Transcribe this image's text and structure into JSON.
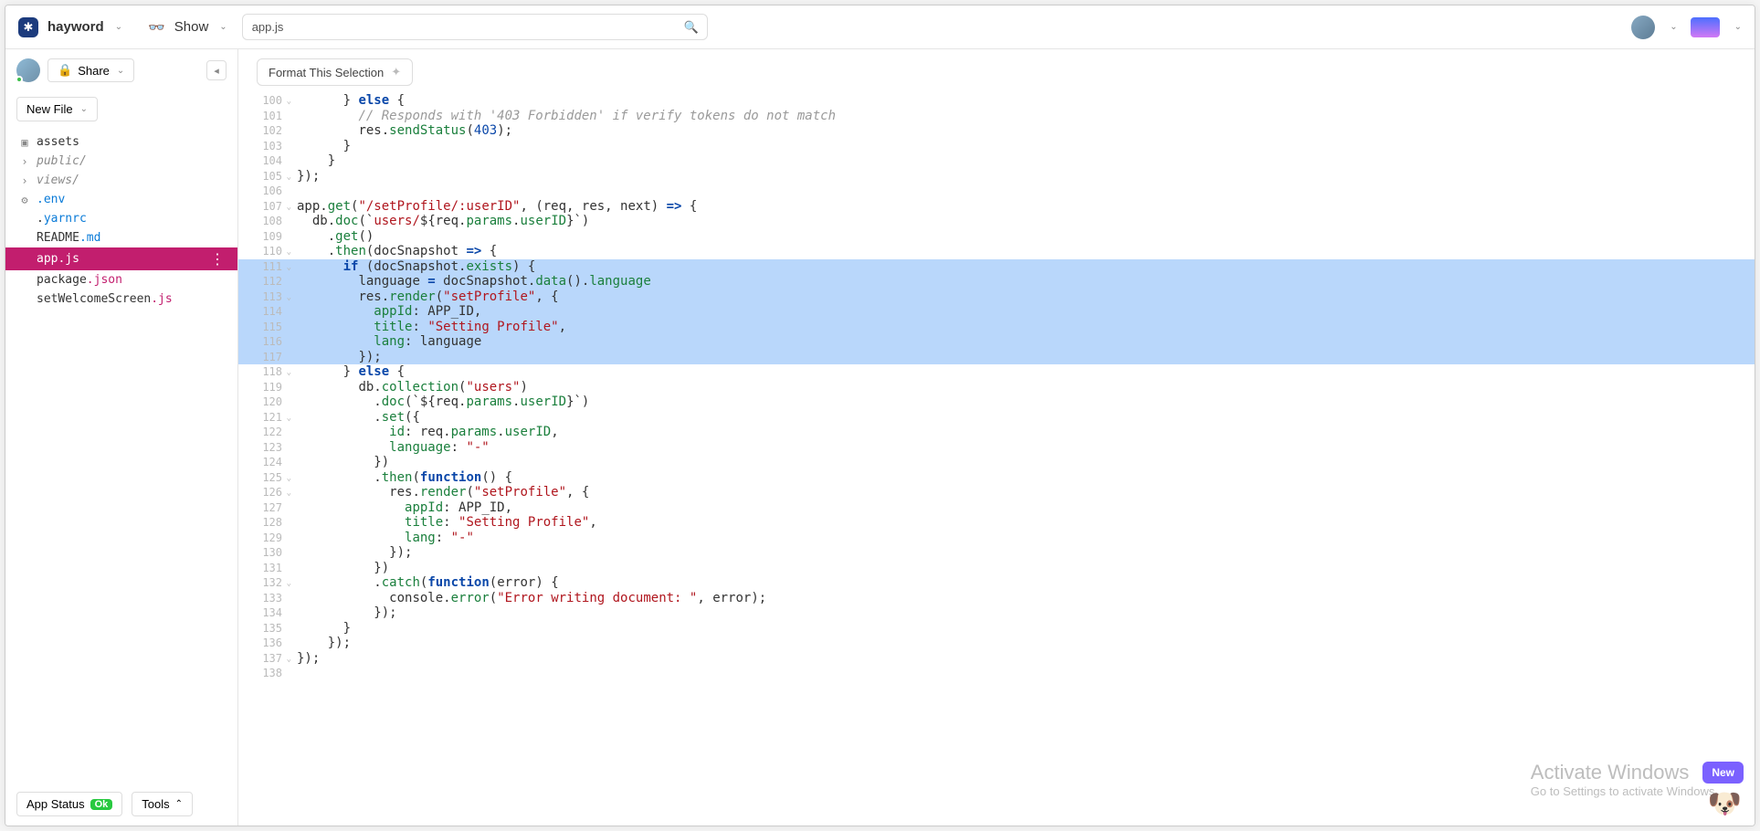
{
  "header": {
    "project": "hayword",
    "show_label": "Show",
    "search_value": "app.js"
  },
  "sidebar": {
    "share_label": "Share",
    "new_file_label": "New File",
    "tree": [
      {
        "icon": "▣",
        "prefix": "",
        "name": "assets",
        "suffix": "",
        "cls": ""
      },
      {
        "icon": "›",
        "prefix": "",
        "name": "public/",
        "suffix": "",
        "cls": "muted"
      },
      {
        "icon": "›",
        "prefix": "",
        "name": "views/",
        "suffix": "",
        "cls": "muted"
      },
      {
        "icon": "⚙",
        "prefix": "",
        "name": ".env",
        "suffix": "",
        "cls": "ext-env"
      },
      {
        "icon": "",
        "prefix": ".",
        "name": "yarnrc",
        "suffix": "",
        "cls": "ext-rc",
        "pname": ".yarnrc"
      },
      {
        "icon": "",
        "prefix": "README",
        "name": ".md",
        "suffix": "",
        "cls": "ext-md"
      },
      {
        "icon": "",
        "prefix": "app",
        "name": ".js",
        "suffix": "",
        "cls": "ext-js",
        "active": true
      },
      {
        "icon": "",
        "prefix": "package",
        "name": ".json",
        "suffix": "",
        "cls": "ext-json"
      },
      {
        "icon": "",
        "prefix": "setWelcomeScreen",
        "name": ".js",
        "suffix": "",
        "cls": "ext-js"
      }
    ],
    "app_status_label": "App Status",
    "app_status_value": "Ok",
    "tools_label": "Tools"
  },
  "editor": {
    "format_btn": "Format This Selection",
    "lines": [
      {
        "num": 100,
        "fold": true,
        "sel": false,
        "indent": "      ",
        "tokens": [
          {
            "t": "} ",
            "c": "id"
          },
          {
            "t": "else",
            "c": "k"
          },
          {
            "t": " {",
            "c": "id"
          }
        ]
      },
      {
        "num": 101,
        "fold": false,
        "sel": false,
        "indent": "        ",
        "tokens": [
          {
            "t": "// Responds with '403 Forbidden' if verify tokens do not match",
            "c": "c"
          }
        ]
      },
      {
        "num": 102,
        "fold": false,
        "sel": false,
        "indent": "        ",
        "tokens": [
          {
            "t": "res.",
            "c": "id"
          },
          {
            "t": "sendStatus",
            "c": "p"
          },
          {
            "t": "(",
            "c": "id"
          },
          {
            "t": "403",
            "c": "n"
          },
          {
            "t": ");",
            "c": "id"
          }
        ]
      },
      {
        "num": 103,
        "fold": false,
        "sel": false,
        "indent": "      ",
        "tokens": [
          {
            "t": "}",
            "c": "id"
          }
        ]
      },
      {
        "num": 104,
        "fold": false,
        "sel": false,
        "indent": "    ",
        "tokens": [
          {
            "t": "}",
            "c": "id"
          }
        ]
      },
      {
        "num": 105,
        "fold": true,
        "sel": false,
        "indent": "",
        "tokens": [
          {
            "t": "});",
            "c": "id"
          }
        ]
      },
      {
        "num": 106,
        "fold": false,
        "sel": false,
        "indent": "",
        "tokens": []
      },
      {
        "num": 107,
        "fold": true,
        "sel": false,
        "indent": "",
        "tokens": [
          {
            "t": "app.",
            "c": "id"
          },
          {
            "t": "get",
            "c": "p"
          },
          {
            "t": "(",
            "c": "id"
          },
          {
            "t": "\"/setProfile/:userID\"",
            "c": "s"
          },
          {
            "t": ", (req, res, next) ",
            "c": "id"
          },
          {
            "t": "=>",
            "c": "op"
          },
          {
            "t": " {",
            "c": "id"
          }
        ]
      },
      {
        "num": 108,
        "fold": false,
        "sel": false,
        "indent": "  ",
        "tokens": [
          {
            "t": "db.",
            "c": "id"
          },
          {
            "t": "doc",
            "c": "p"
          },
          {
            "t": "(`",
            "c": "id"
          },
          {
            "t": "users/",
            "c": "tmpl"
          },
          {
            "t": "${req.",
            "c": "id"
          },
          {
            "t": "params",
            "c": "p"
          },
          {
            "t": ".",
            "c": "id"
          },
          {
            "t": "userID",
            "c": "p"
          },
          {
            "t": "}",
            "c": "id"
          },
          {
            "t": "`)",
            "c": "id"
          }
        ]
      },
      {
        "num": 109,
        "fold": false,
        "sel": false,
        "indent": "    ",
        "tokens": [
          {
            "t": ".",
            "c": "id"
          },
          {
            "t": "get",
            "c": "p"
          },
          {
            "t": "()",
            "c": "id"
          }
        ]
      },
      {
        "num": 110,
        "fold": true,
        "sel": false,
        "indent": "    ",
        "tokens": [
          {
            "t": ".",
            "c": "id"
          },
          {
            "t": "then",
            "c": "p"
          },
          {
            "t": "(docSnapshot ",
            "c": "id"
          },
          {
            "t": "=>",
            "c": "op"
          },
          {
            "t": " {",
            "c": "id"
          }
        ]
      },
      {
        "num": 111,
        "fold": true,
        "sel": true,
        "indent": "      ",
        "tokens": [
          {
            "t": "if",
            "c": "k"
          },
          {
            "t": " (docSnapshot.",
            "c": "id"
          },
          {
            "t": "exists",
            "c": "p"
          },
          {
            "t": ") {",
            "c": "id"
          }
        ]
      },
      {
        "num": 112,
        "fold": false,
        "sel": true,
        "indent": "        ",
        "tokens": [
          {
            "t": "language ",
            "c": "id"
          },
          {
            "t": "=",
            "c": "op"
          },
          {
            "t": " docSnapshot.",
            "c": "id"
          },
          {
            "t": "data",
            "c": "p"
          },
          {
            "t": "().",
            "c": "id"
          },
          {
            "t": "language",
            "c": "p"
          }
        ]
      },
      {
        "num": 113,
        "fold": true,
        "sel": true,
        "indent": "        ",
        "tokens": [
          {
            "t": "res.",
            "c": "id"
          },
          {
            "t": "render",
            "c": "p"
          },
          {
            "t": "(",
            "c": "id"
          },
          {
            "t": "\"setProfile\"",
            "c": "s"
          },
          {
            "t": ", {",
            "c": "id"
          }
        ]
      },
      {
        "num": 114,
        "fold": false,
        "sel": true,
        "indent": "          ",
        "tokens": [
          {
            "t": "appId",
            "c": "p"
          },
          {
            "t": ": APP_ID,",
            "c": "id"
          }
        ]
      },
      {
        "num": 115,
        "fold": false,
        "sel": true,
        "indent": "          ",
        "tokens": [
          {
            "t": "title",
            "c": "p"
          },
          {
            "t": ": ",
            "c": "id"
          },
          {
            "t": "\"Setting Profile\"",
            "c": "s"
          },
          {
            "t": ",",
            "c": "id"
          }
        ]
      },
      {
        "num": 116,
        "fold": false,
        "sel": true,
        "indent": "          ",
        "tokens": [
          {
            "t": "lang",
            "c": "p"
          },
          {
            "t": ": language",
            "c": "id"
          }
        ]
      },
      {
        "num": 117,
        "fold": false,
        "sel": true,
        "indent": "        ",
        "tokens": [
          {
            "t": "});",
            "c": "id"
          }
        ]
      },
      {
        "num": 118,
        "fold": true,
        "sel": false,
        "indent": "      ",
        "tokens": [
          {
            "t": "} ",
            "c": "id"
          },
          {
            "t": "else",
            "c": "k"
          },
          {
            "t": " {",
            "c": "id"
          }
        ]
      },
      {
        "num": 119,
        "fold": false,
        "sel": false,
        "indent": "        ",
        "tokens": [
          {
            "t": "db.",
            "c": "id"
          },
          {
            "t": "collection",
            "c": "p"
          },
          {
            "t": "(",
            "c": "id"
          },
          {
            "t": "\"users\"",
            "c": "s"
          },
          {
            "t": ")",
            "c": "id"
          }
        ]
      },
      {
        "num": 120,
        "fold": false,
        "sel": false,
        "indent": "          ",
        "tokens": [
          {
            "t": ".",
            "c": "id"
          },
          {
            "t": "doc",
            "c": "p"
          },
          {
            "t": "(`",
            "c": "id"
          },
          {
            "t": "${req.",
            "c": "id"
          },
          {
            "t": "params",
            "c": "p"
          },
          {
            "t": ".",
            "c": "id"
          },
          {
            "t": "userID",
            "c": "p"
          },
          {
            "t": "}",
            "c": "id"
          },
          {
            "t": "`)",
            "c": "id"
          }
        ]
      },
      {
        "num": 121,
        "fold": true,
        "sel": false,
        "indent": "          ",
        "tokens": [
          {
            "t": ".",
            "c": "id"
          },
          {
            "t": "set",
            "c": "p"
          },
          {
            "t": "({",
            "c": "id"
          }
        ]
      },
      {
        "num": 122,
        "fold": false,
        "sel": false,
        "indent": "            ",
        "tokens": [
          {
            "t": "id",
            "c": "p"
          },
          {
            "t": ": req.",
            "c": "id"
          },
          {
            "t": "params",
            "c": "p"
          },
          {
            "t": ".",
            "c": "id"
          },
          {
            "t": "userID",
            "c": "p"
          },
          {
            "t": ",",
            "c": "id"
          }
        ]
      },
      {
        "num": 123,
        "fold": false,
        "sel": false,
        "indent": "            ",
        "tokens": [
          {
            "t": "language",
            "c": "p"
          },
          {
            "t": ": ",
            "c": "id"
          },
          {
            "t": "\"-\"",
            "c": "s"
          }
        ]
      },
      {
        "num": 124,
        "fold": false,
        "sel": false,
        "indent": "          ",
        "tokens": [
          {
            "t": "})",
            "c": "id"
          }
        ]
      },
      {
        "num": 125,
        "fold": true,
        "sel": false,
        "indent": "          ",
        "tokens": [
          {
            "t": ".",
            "c": "id"
          },
          {
            "t": "then",
            "c": "p"
          },
          {
            "t": "(",
            "c": "id"
          },
          {
            "t": "function",
            "c": "k"
          },
          {
            "t": "() {",
            "c": "id"
          }
        ]
      },
      {
        "num": 126,
        "fold": true,
        "sel": false,
        "indent": "            ",
        "tokens": [
          {
            "t": "res.",
            "c": "id"
          },
          {
            "t": "render",
            "c": "p"
          },
          {
            "t": "(",
            "c": "id"
          },
          {
            "t": "\"setProfile\"",
            "c": "s"
          },
          {
            "t": ", {",
            "c": "id"
          }
        ]
      },
      {
        "num": 127,
        "fold": false,
        "sel": false,
        "indent": "              ",
        "tokens": [
          {
            "t": "appId",
            "c": "p"
          },
          {
            "t": ": APP_ID,",
            "c": "id"
          }
        ]
      },
      {
        "num": 128,
        "fold": false,
        "sel": false,
        "indent": "              ",
        "tokens": [
          {
            "t": "title",
            "c": "p"
          },
          {
            "t": ": ",
            "c": "id"
          },
          {
            "t": "\"Setting Profile\"",
            "c": "s"
          },
          {
            "t": ",",
            "c": "id"
          }
        ]
      },
      {
        "num": 129,
        "fold": false,
        "sel": false,
        "indent": "              ",
        "tokens": [
          {
            "t": "lang",
            "c": "p"
          },
          {
            "t": ": ",
            "c": "id"
          },
          {
            "t": "\"-\"",
            "c": "s"
          }
        ]
      },
      {
        "num": 130,
        "fold": false,
        "sel": false,
        "indent": "            ",
        "tokens": [
          {
            "t": "});",
            "c": "id"
          }
        ]
      },
      {
        "num": 131,
        "fold": false,
        "sel": false,
        "indent": "          ",
        "tokens": [
          {
            "t": "})",
            "c": "id"
          }
        ]
      },
      {
        "num": 132,
        "fold": true,
        "sel": false,
        "indent": "          ",
        "tokens": [
          {
            "t": ".",
            "c": "id"
          },
          {
            "t": "catch",
            "c": "p"
          },
          {
            "t": "(",
            "c": "id"
          },
          {
            "t": "function",
            "c": "k"
          },
          {
            "t": "(error) {",
            "c": "id"
          }
        ]
      },
      {
        "num": 133,
        "fold": false,
        "sel": false,
        "indent": "            ",
        "tokens": [
          {
            "t": "console.",
            "c": "id"
          },
          {
            "t": "error",
            "c": "p"
          },
          {
            "t": "(",
            "c": "id"
          },
          {
            "t": "\"Error writing document: \"",
            "c": "s"
          },
          {
            "t": ", error);",
            "c": "id"
          }
        ]
      },
      {
        "num": 134,
        "fold": false,
        "sel": false,
        "indent": "          ",
        "tokens": [
          {
            "t": "});",
            "c": "id"
          }
        ]
      },
      {
        "num": 135,
        "fold": false,
        "sel": false,
        "indent": "      ",
        "tokens": [
          {
            "t": "}",
            "c": "id"
          }
        ]
      },
      {
        "num": 136,
        "fold": false,
        "sel": false,
        "indent": "    ",
        "tokens": [
          {
            "t": "});",
            "c": "id"
          }
        ]
      },
      {
        "num": 137,
        "fold": true,
        "sel": false,
        "indent": "",
        "tokens": [
          {
            "t": "});",
            "c": "id"
          }
        ]
      },
      {
        "num": 138,
        "fold": false,
        "sel": false,
        "indent": "",
        "tokens": []
      }
    ]
  },
  "overlay": {
    "watermark_l1": "Activate Windows",
    "watermark_l2": "Go to Settings to activate Windows.",
    "new_badge": "New"
  }
}
